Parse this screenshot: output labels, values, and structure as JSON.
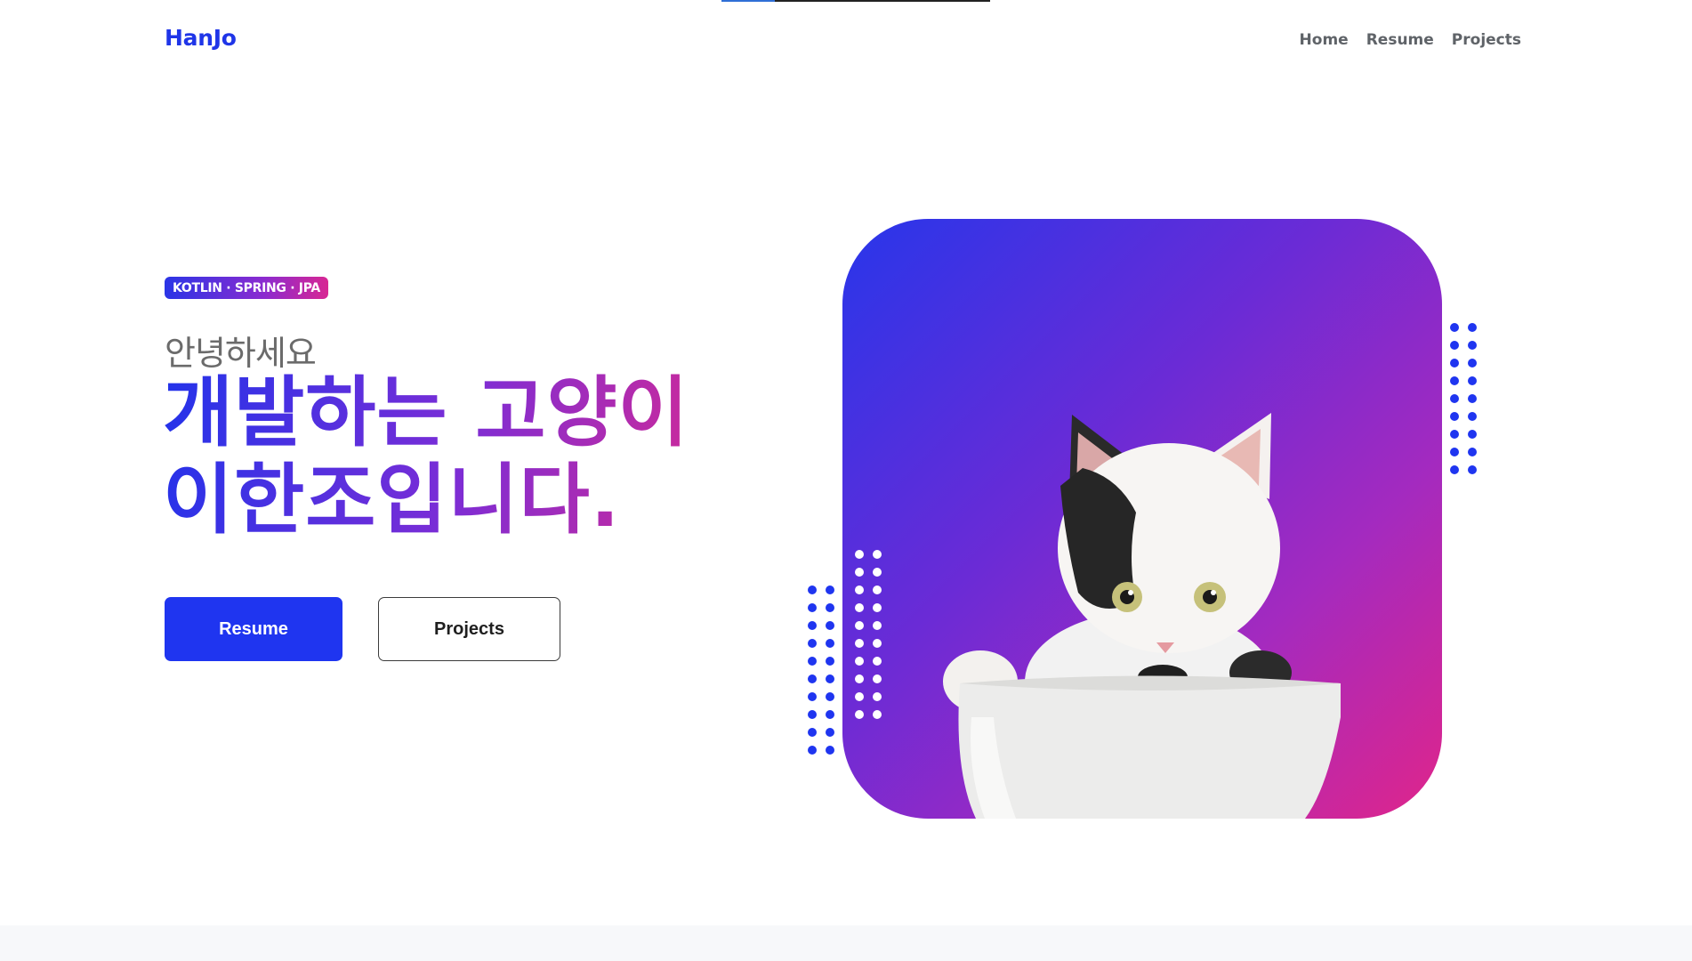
{
  "nav": {
    "logo": "HanJo",
    "links": [
      "Home",
      "Resume",
      "Projects"
    ]
  },
  "hero": {
    "badge": "KOTLIN · SPRING · JPA",
    "greeting": "안녕하세요",
    "headline_line1": "개발하는 고양이",
    "headline_line2": "이한조입니다.",
    "primary_button": "Resume",
    "secondary_button": "Projects"
  },
  "colors": {
    "accent": "#1f35e8",
    "gradient_start": "#2836ea",
    "gradient_end": "#e0258a"
  },
  "icons": [
    "dot-pattern",
    "cat-in-cup-illustration"
  ]
}
